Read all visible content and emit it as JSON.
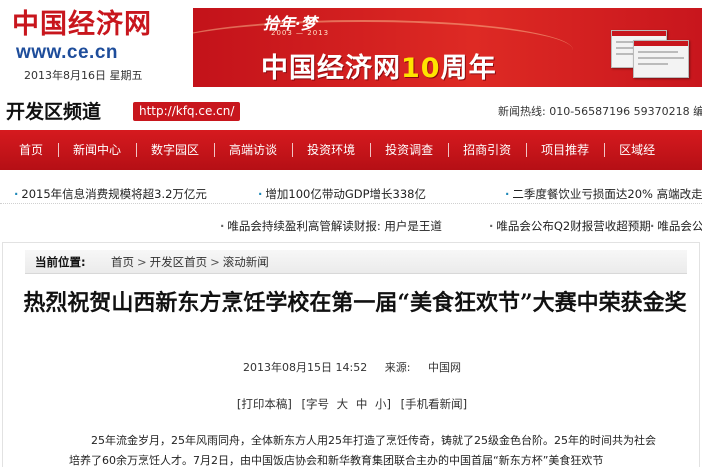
{
  "header": {
    "logo_cn": "中国经济网",
    "logo_url": "www.ce.cn",
    "date": "2013年8月16日",
    "weekday": "星期五",
    "banner": {
      "anniversary": "拾年·梦",
      "anniversary_years": "2003 — 2013",
      "title_prefix": "中国经济网",
      "title_number": "10",
      "title_suffix": "周年"
    }
  },
  "channel": {
    "title": "开发区频道",
    "url": "http://kfq.ce.cn/",
    "hotline_label": "新闻热线:",
    "hotline_numbers": "010-56587196 59370218 编"
  },
  "nav": [
    {
      "label": "首页",
      "name": "nav-home"
    },
    {
      "label": "新闻中心",
      "name": "nav-news"
    },
    {
      "label": "数字园区",
      "name": "nav-digital-park"
    },
    {
      "label": "高端访谈",
      "name": "nav-interview"
    },
    {
      "label": "投资环境",
      "name": "nav-investment"
    },
    {
      "label": "投资调查",
      "name": "nav-survey"
    },
    {
      "label": "招商引资",
      "name": "nav-attract"
    },
    {
      "label": "项目推荐",
      "name": "nav-projects"
    },
    {
      "label": "区域经",
      "name": "nav-regional"
    }
  ],
  "ticker": {
    "row1": [
      "2015年信息消费规模将超3.2万亿元",
      "增加100亿带动GDP增长338亿",
      "二季度餐饮业亏损面达20% 高端改走"
    ],
    "row2": [
      "唯品会持续盈利高管解读财报: 用户是王道",
      "唯品会公布Q2财报营收超预期",
      "唯品会公"
    ]
  },
  "breadcrumb": {
    "label": "当前位置:",
    "items": [
      "首页",
      "开发区首页",
      "滚动新闻"
    ],
    "separator": ">"
  },
  "article": {
    "title": "热烈祝贺山西新东方烹饪学校在第一届“美食狂欢节”大赛中荣获金奖",
    "datetime": "2013年08月15日 14:52",
    "source_label": "来源:",
    "source": "中国网",
    "tools": {
      "print": "[打印本稿]",
      "font_label": "[字号",
      "font_large": "大",
      "font_medium": "中",
      "font_small": "小]",
      "mobile": "[手机看新闻]"
    },
    "body": "25年流金岁月，25年风雨同舟，全体新东方人用25年打造了烹饪传奇，铸就了25级金色台阶。25年的时间共为社会培养了60余万烹饪人才。7月2日，由中国饭店协会和新华教育集团联合主办的中国首届“新东方杯”美食狂欢节"
  }
}
